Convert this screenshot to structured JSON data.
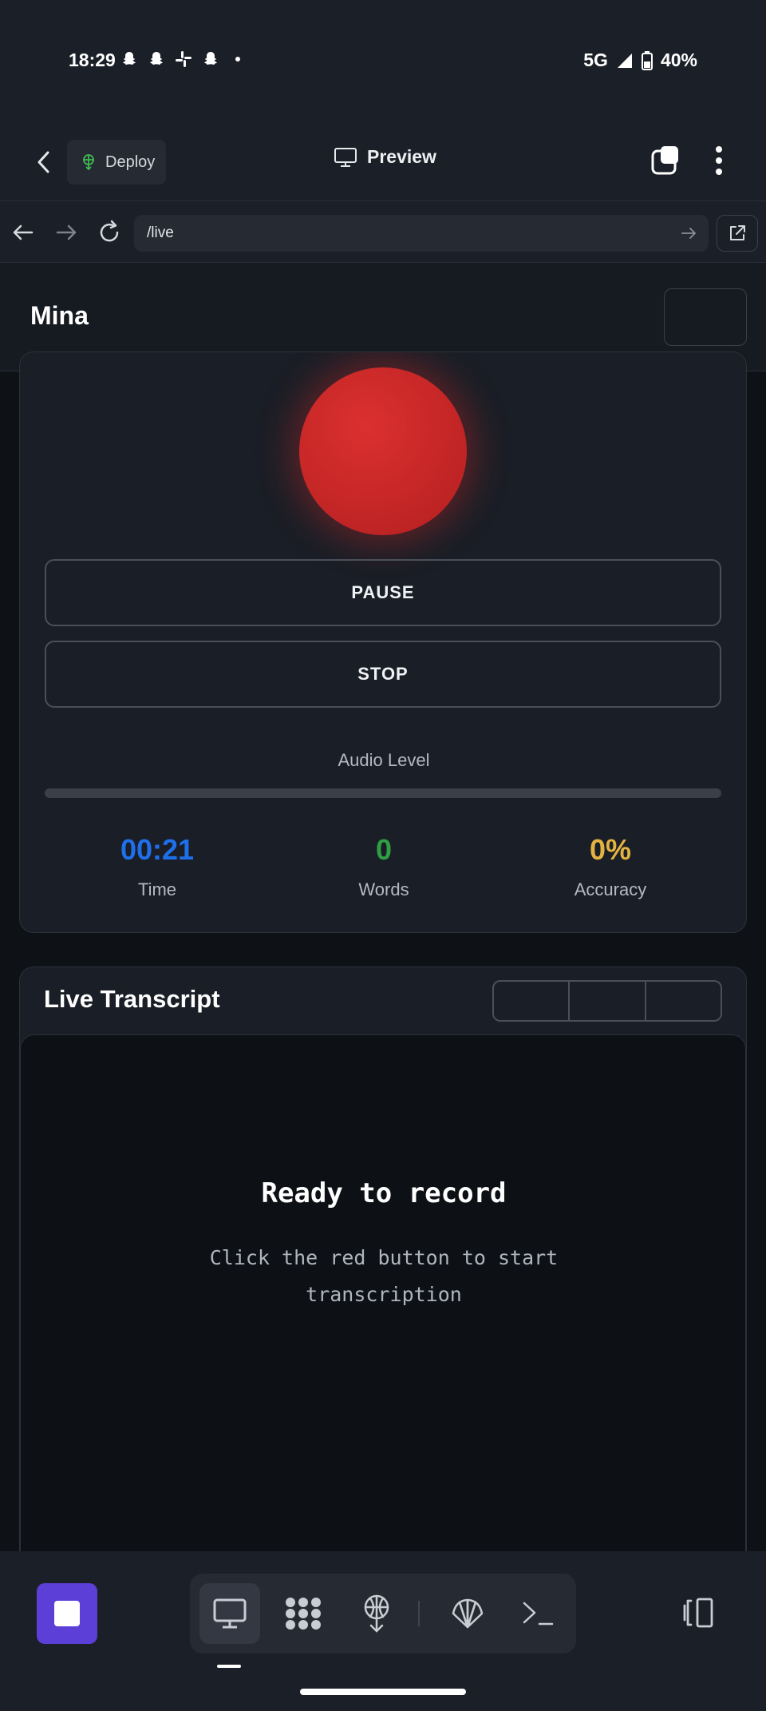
{
  "status_bar": {
    "time": "18:29",
    "notification_icons": [
      "snapchat-icon",
      "snapchat-icon",
      "slack-icon",
      "snapchat-icon",
      "dot-icon"
    ],
    "network": "5G",
    "battery": "40%"
  },
  "app_bar": {
    "deploy_label": "Deploy",
    "title": "Preview"
  },
  "url_bar": {
    "url": "/live"
  },
  "site": {
    "brand": "Mina"
  },
  "recorder": {
    "record_state": "recording",
    "pause_label": "PAUSE",
    "stop_label": "STOP",
    "audio_label": "Audio Level",
    "audio_level": 0,
    "stats": [
      {
        "value": "00:21",
        "label": "Time",
        "color": "#1f6feb"
      },
      {
        "value": "0",
        "label": "Words",
        "color": "#2ea043"
      },
      {
        "value": "0%",
        "label": "Accuracy",
        "color": "#e3b341"
      }
    ]
  },
  "transcript": {
    "title": "Live Transcript",
    "empty_title": "Ready to record",
    "empty_sub": "Click the red button to start transcription"
  },
  "bottom_bar": {
    "tools": [
      "monitor-icon",
      "grid-blobs-icon",
      "deploy-icon",
      "shell-icon",
      "terminal-icon"
    ],
    "active_tool": "monitor-icon"
  },
  "colors": {
    "accent": "#5b3fd6",
    "record": "#d32a2a"
  }
}
